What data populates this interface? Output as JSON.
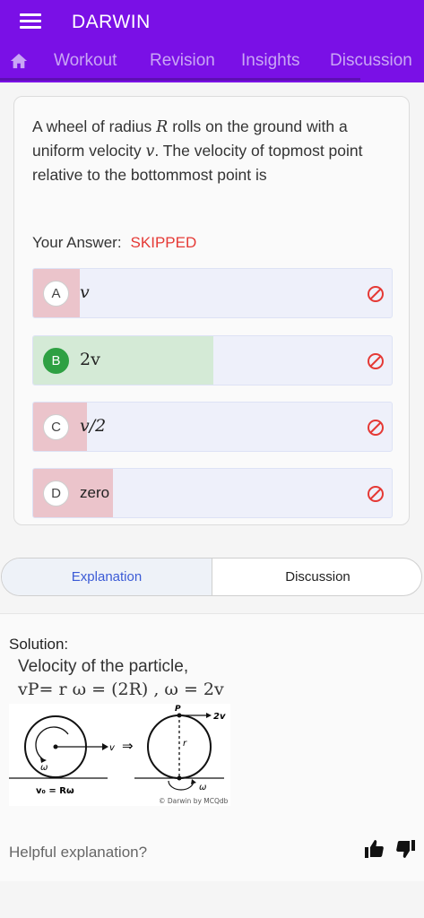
{
  "app": {
    "title": "DARWIN"
  },
  "tabs": [
    "Workout",
    "Revision",
    "Insights",
    "Discussion"
  ],
  "question": {
    "text_1": "A wheel of radius ",
    "var_R": "R",
    "text_2": " rolls on the ground with a uniform velocity ",
    "var_v": "v",
    "text_3": ". The velocity of topmost point relative to the bottommost point is"
  },
  "your_answer": {
    "label": "Your Answer:",
    "status": "SKIPPED"
  },
  "options": [
    {
      "letter": "A",
      "text": "v"
    },
    {
      "letter": "B",
      "text": "2v"
    },
    {
      "letter": "C",
      "text": "v/2"
    },
    {
      "letter": "D",
      "text": "zero"
    }
  ],
  "segments": {
    "explanation": "Explanation",
    "discussion": "Discussion"
  },
  "solution": {
    "heading": "Solution:",
    "line1": "Velocity of the particle,",
    "line2": "vP= r ω = (2R) , ω = 2v",
    "figure": {
      "left_velocity": "v",
      "omega": "ω",
      "left_caption": "v₀ = Rω",
      "arrow": "⇒",
      "top_point": "P",
      "top_velocity": "2v",
      "radius": "r",
      "copyright": "© Darwin by MCQdb"
    }
  },
  "feedback": {
    "label": "Helpful explanation?"
  },
  "colors": {
    "brand": "#7a10e6",
    "wrong_fill": "#ebc4cb",
    "correct_fill": "#d4ead6",
    "correct_badge": "#2ea043",
    "skipped": "#e53935",
    "link": "#3b5bd6"
  }
}
